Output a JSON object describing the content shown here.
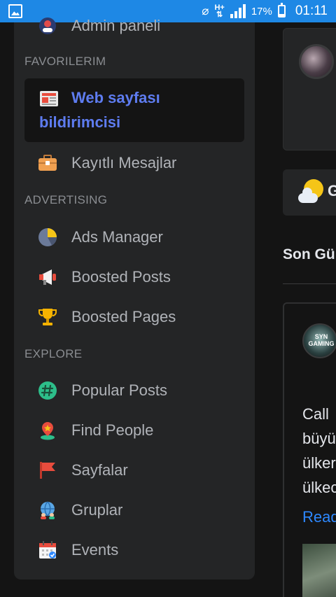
{
  "status_bar": {
    "battery": "17%",
    "time": "01:11",
    "network": "H+"
  },
  "sidebar": {
    "top_item": "Admin paneli",
    "sections": {
      "favorites": "FAVORILERIM",
      "advertising": "ADVERTISING",
      "explore": "EXPLORE"
    },
    "favorites": [
      {
        "line1": "Web sayfası",
        "line2": "bildirimcisi",
        "icon": "newspaper-icon",
        "active": true
      },
      {
        "label": "Kayıtlı Mesajlar",
        "icon": "briefcase-icon"
      }
    ],
    "advertising": [
      {
        "label": "Ads Manager",
        "icon": "pie-chart-icon"
      },
      {
        "label": "Boosted Posts",
        "icon": "megaphone-icon"
      },
      {
        "label": "Boosted Pages",
        "icon": "trophy-icon"
      }
    ],
    "explore": [
      {
        "label": "Popular Posts",
        "icon": "hashtag-icon"
      },
      {
        "label": "Find People",
        "icon": "person-pin-icon"
      },
      {
        "label": "Sayfalar",
        "icon": "flag-icon"
      },
      {
        "label": "Gruplar",
        "icon": "globe-group-icon"
      },
      {
        "label": "Events",
        "icon": "calendar-icon"
      }
    ]
  },
  "main": {
    "weather_text": "G",
    "heading": "Son Gü",
    "post": {
      "avatar_text": "SYN GAMING",
      "text": "Call \nbüyü\nülker\nülkec",
      "read_more": "Read"
    }
  },
  "colors": {
    "status_bar": "#1e88e5",
    "active_link": "#5e7cf0",
    "link": "#2d88ff"
  }
}
